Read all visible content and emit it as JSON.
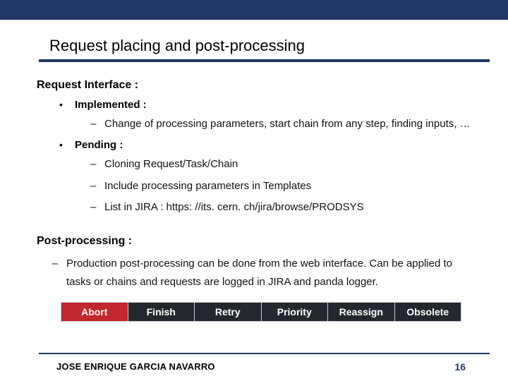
{
  "slide": {
    "title": "Request placing and post-processing",
    "sections": {
      "request_interface": {
        "heading": "Request Interface :",
        "implemented": {
          "label": "Implemented :",
          "items": [
            "Change of processing parameters, start chain from any step, finding inputs, …"
          ]
        },
        "pending": {
          "label": "Pending :",
          "items": [
            "Cloning Request/Task/Chain",
            "Include processing parameters in Templates",
            "List in JIRA : https: //its. cern. ch/jira/browse/PRODSYS"
          ]
        }
      },
      "post_processing": {
        "heading": "Post-processing :",
        "items": [
          "Production post-processing can be done from the web interface. Can be applied to tasks or chains and requests are logged in JIRA and panda logger."
        ]
      }
    },
    "buttons": [
      "Abort",
      "Finish",
      "Retry",
      "Priority",
      "Reassign",
      "Obsolete"
    ],
    "footer": {
      "author": "JOSE ENRIQUE GARCIA NAVARRO",
      "page": "16"
    }
  }
}
